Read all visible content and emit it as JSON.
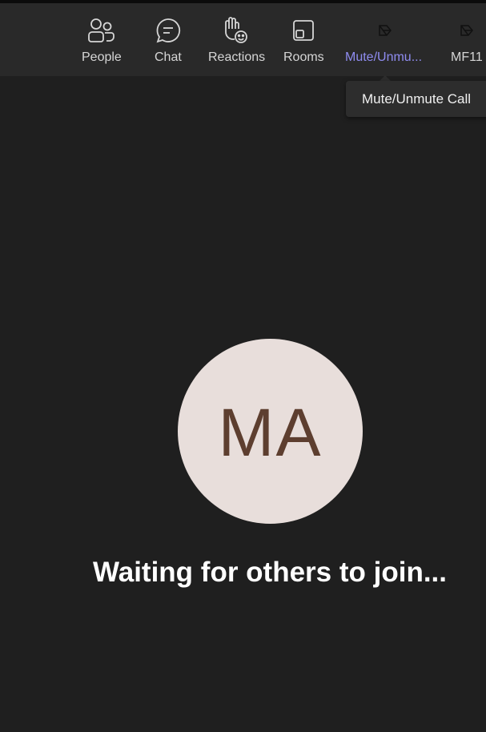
{
  "toolbar": {
    "items": [
      {
        "label": "People",
        "icon": "people-icon"
      },
      {
        "label": "Chat",
        "icon": "chat-icon"
      },
      {
        "label": "Reactions",
        "icon": "reactions-icon"
      },
      {
        "label": "Rooms",
        "icon": "rooms-icon"
      },
      {
        "label": "Mute/Unmu...",
        "icon": "app-icon",
        "active": true
      },
      {
        "label": "MF11",
        "icon": "app-icon"
      }
    ]
  },
  "tooltip": {
    "text": "Mute/Unmute Call"
  },
  "stage": {
    "avatar_initials": "MA",
    "waiting_text": "Waiting for others to join..."
  },
  "colors": {
    "background": "#1f1f1f",
    "toolbar": "#292929",
    "active_label": "#8f8cf0",
    "avatar_bg": "#e8dedb",
    "avatar_text": "#5d3e2f"
  }
}
